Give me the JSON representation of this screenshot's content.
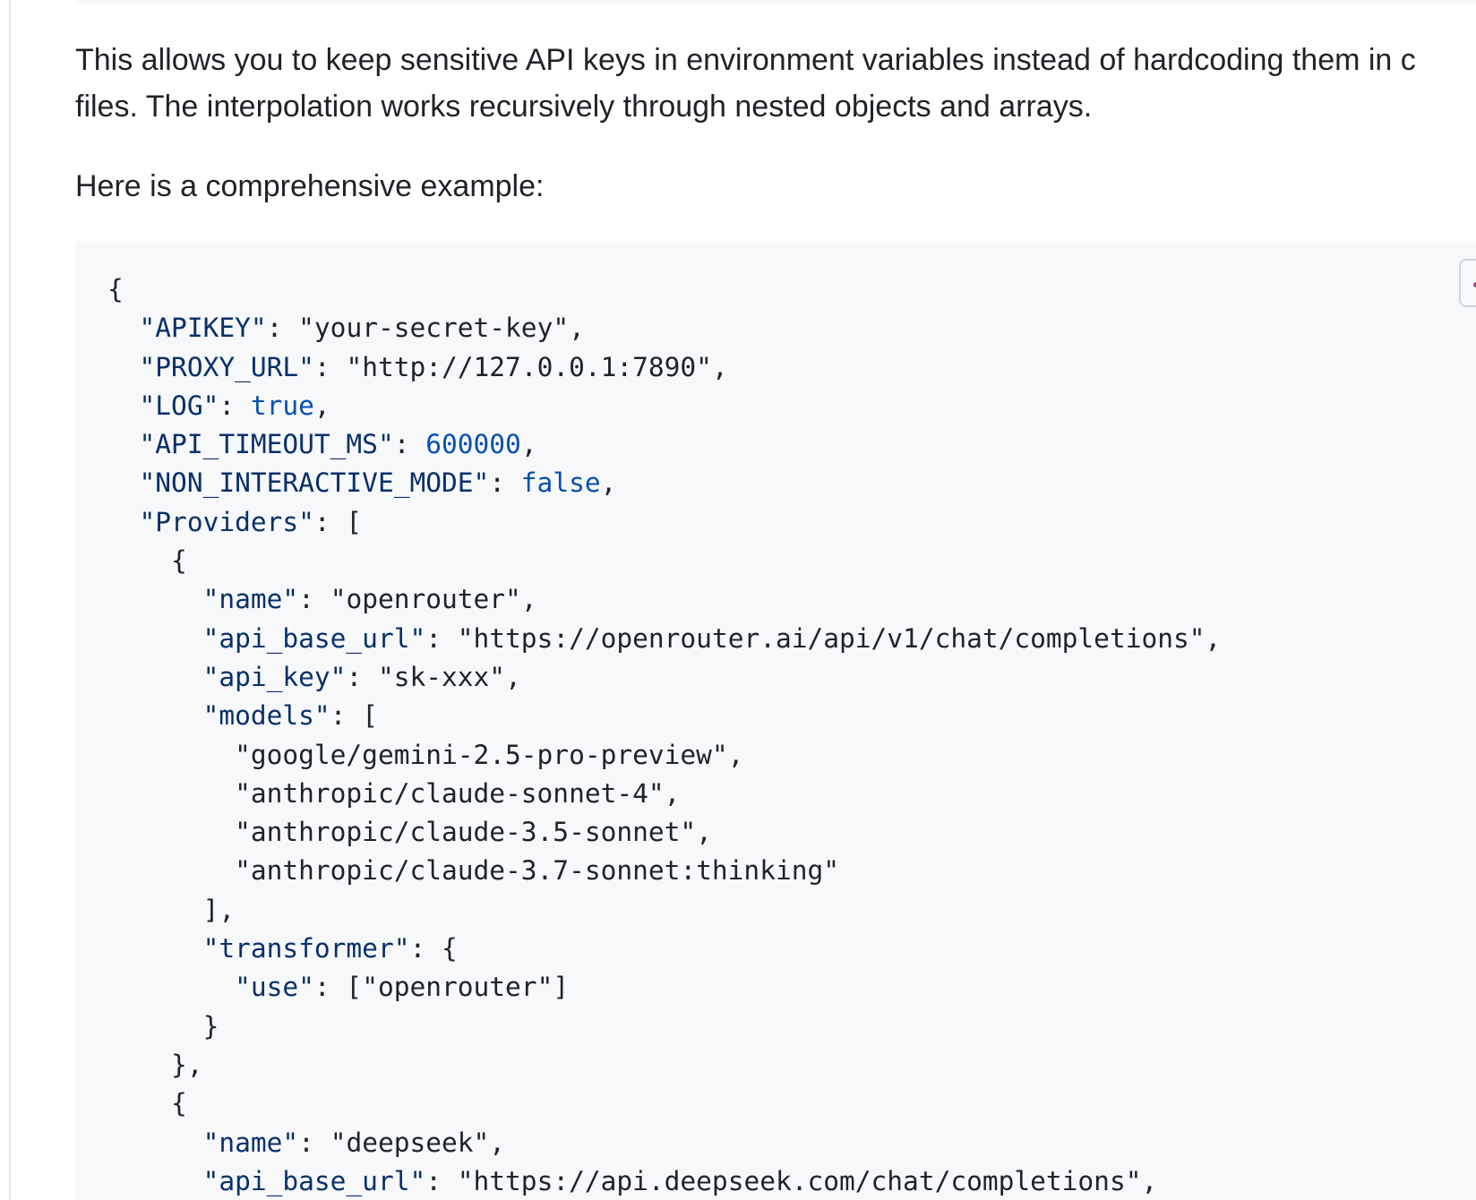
{
  "document": {
    "paragraph1": {
      "line1": "This allows you to keep sensitive API keys in environment variables instead of hardcoding them in c",
      "line2": "files. The interpolation works recursively through nested objects and arrays."
    },
    "paragraph2": "Here is a comprehensive example:"
  },
  "code_block": {
    "language": "json",
    "copy_icon": "copy-icon",
    "lines": [
      [
        {
          "t": "p",
          "v": "{"
        }
      ],
      [
        {
          "t": "p",
          "v": "  "
        },
        {
          "t": "k",
          "v": "\"APIKEY\""
        },
        {
          "t": "p",
          "v": ": "
        },
        {
          "t": "s",
          "v": "\"your-secret-key\""
        },
        {
          "t": "p",
          "v": ","
        }
      ],
      [
        {
          "t": "p",
          "v": "  "
        },
        {
          "t": "k",
          "v": "\"PROXY_URL\""
        },
        {
          "t": "p",
          "v": ": "
        },
        {
          "t": "s",
          "v": "\"http://127.0.0.1:7890\""
        },
        {
          "t": "p",
          "v": ","
        }
      ],
      [
        {
          "t": "p",
          "v": "  "
        },
        {
          "t": "k",
          "v": "\"LOG\""
        },
        {
          "t": "p",
          "v": ": "
        },
        {
          "t": "l",
          "v": "true"
        },
        {
          "t": "p",
          "v": ","
        }
      ],
      [
        {
          "t": "p",
          "v": "  "
        },
        {
          "t": "k",
          "v": "\"API_TIMEOUT_MS\""
        },
        {
          "t": "p",
          "v": ": "
        },
        {
          "t": "l",
          "v": "600000"
        },
        {
          "t": "p",
          "v": ","
        }
      ],
      [
        {
          "t": "p",
          "v": "  "
        },
        {
          "t": "k",
          "v": "\"NON_INTERACTIVE_MODE\""
        },
        {
          "t": "p",
          "v": ": "
        },
        {
          "t": "l",
          "v": "false"
        },
        {
          "t": "p",
          "v": ","
        }
      ],
      [
        {
          "t": "p",
          "v": "  "
        },
        {
          "t": "k",
          "v": "\"Providers\""
        },
        {
          "t": "p",
          "v": ": ["
        }
      ],
      [
        {
          "t": "p",
          "v": "    {"
        }
      ],
      [
        {
          "t": "p",
          "v": "      "
        },
        {
          "t": "k",
          "v": "\"name\""
        },
        {
          "t": "p",
          "v": ": "
        },
        {
          "t": "s",
          "v": "\"openrouter\""
        },
        {
          "t": "p",
          "v": ","
        }
      ],
      [
        {
          "t": "p",
          "v": "      "
        },
        {
          "t": "k",
          "v": "\"api_base_url\""
        },
        {
          "t": "p",
          "v": ": "
        },
        {
          "t": "s",
          "v": "\"https://openrouter.ai/api/v1/chat/completions\""
        },
        {
          "t": "p",
          "v": ","
        }
      ],
      [
        {
          "t": "p",
          "v": "      "
        },
        {
          "t": "k",
          "v": "\"api_key\""
        },
        {
          "t": "p",
          "v": ": "
        },
        {
          "t": "s",
          "v": "\"sk-xxx\""
        },
        {
          "t": "p",
          "v": ","
        }
      ],
      [
        {
          "t": "p",
          "v": "      "
        },
        {
          "t": "k",
          "v": "\"models\""
        },
        {
          "t": "p",
          "v": ": ["
        }
      ],
      [
        {
          "t": "p",
          "v": "        "
        },
        {
          "t": "s",
          "v": "\"google/gemini-2.5-pro-preview\""
        },
        {
          "t": "p",
          "v": ","
        }
      ],
      [
        {
          "t": "p",
          "v": "        "
        },
        {
          "t": "s",
          "v": "\"anthropic/claude-sonnet-4\""
        },
        {
          "t": "p",
          "v": ","
        }
      ],
      [
        {
          "t": "p",
          "v": "        "
        },
        {
          "t": "s",
          "v": "\"anthropic/claude-3.5-sonnet\""
        },
        {
          "t": "p",
          "v": ","
        }
      ],
      [
        {
          "t": "p",
          "v": "        "
        },
        {
          "t": "s",
          "v": "\"anthropic/claude-3.7-sonnet:thinking\""
        }
      ],
      [
        {
          "t": "p",
          "v": "      ],"
        }
      ],
      [
        {
          "t": "p",
          "v": "      "
        },
        {
          "t": "k",
          "v": "\"transformer\""
        },
        {
          "t": "p",
          "v": ": {"
        }
      ],
      [
        {
          "t": "p",
          "v": "        "
        },
        {
          "t": "k",
          "v": "\"use\""
        },
        {
          "t": "p",
          "v": ": ["
        },
        {
          "t": "s",
          "v": "\"openrouter\""
        },
        {
          "t": "p",
          "v": "]"
        }
      ],
      [
        {
          "t": "p",
          "v": "      }"
        }
      ],
      [
        {
          "t": "p",
          "v": "    },"
        }
      ],
      [
        {
          "t": "p",
          "v": "    {"
        }
      ],
      [
        {
          "t": "p",
          "v": "      "
        },
        {
          "t": "k",
          "v": "\"name\""
        },
        {
          "t": "p",
          "v": ": "
        },
        {
          "t": "s",
          "v": "\"deepseek\""
        },
        {
          "t": "p",
          "v": ","
        }
      ],
      [
        {
          "t": "p",
          "v": "      "
        },
        {
          "t": "k",
          "v": "\"api_base_url\""
        },
        {
          "t": "p",
          "v": ": "
        },
        {
          "t": "s",
          "v": "\"https://api.deepseek.com/chat/completions\""
        },
        {
          "t": "p",
          "v": ","
        }
      ]
    ]
  },
  "colors": {
    "text": "#1f2328",
    "code_key": "#0a3069",
    "code_literal": "#0550ae",
    "code_background": "#f6f8fa",
    "border": "#d0d7de"
  }
}
